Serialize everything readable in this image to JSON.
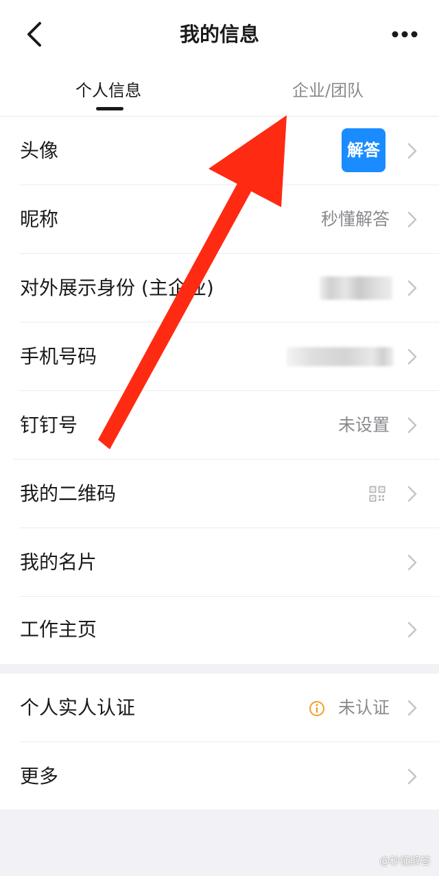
{
  "header": {
    "title": "我的信息"
  },
  "tabs": [
    {
      "label": "个人信息",
      "active": true
    },
    {
      "label": "企业/团队",
      "active": false
    }
  ],
  "rows": {
    "avatar": {
      "label": "头像",
      "avatar_text": "解答"
    },
    "nickname": {
      "label": "昵称",
      "value": "秒懂解答"
    },
    "identity": {
      "label": "对外展示身份 (主企业)"
    },
    "phone": {
      "label": "手机号码"
    },
    "dingtalk_id": {
      "label": "钉钉号",
      "value": "未设置"
    },
    "qrcode": {
      "label": "我的二维码"
    },
    "card": {
      "label": "我的名片"
    },
    "homepage": {
      "label": "工作主页"
    },
    "verification": {
      "label": "个人实人认证",
      "value": "未认证"
    },
    "more": {
      "label": "更多"
    }
  },
  "watermark": "@秒懂解答",
  "colors": {
    "accent_blue": "#1a8cff",
    "annotation_arrow": "#ff2a12",
    "warning": "#f0a020"
  }
}
